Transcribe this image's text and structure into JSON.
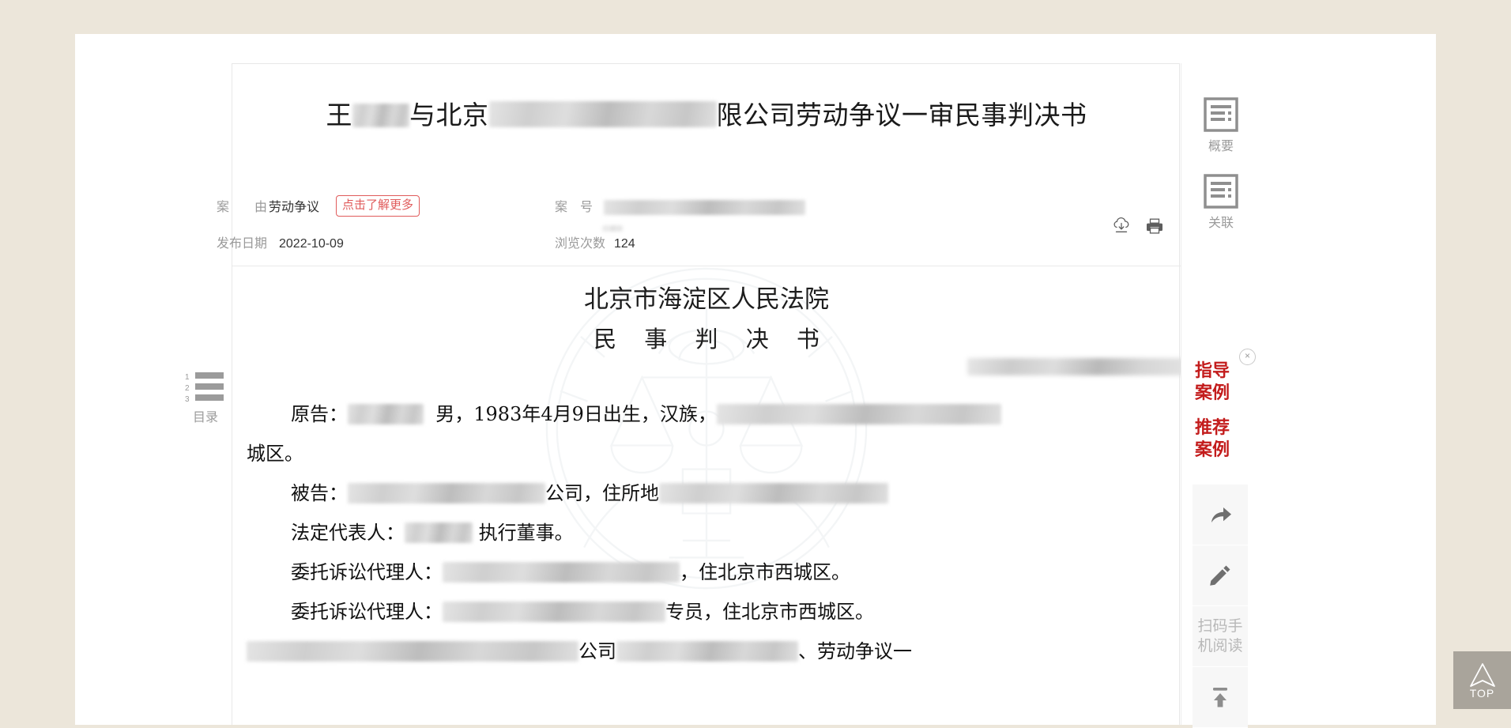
{
  "document": {
    "title_prefix": "王",
    "title_mid": "与北京",
    "title_suffix": "限公司劳动争议一审民事判决书",
    "court_name": "北京市海淀区人民法院",
    "doc_type": "民 事 判 决 书"
  },
  "meta": {
    "case_cause_label": "案　　由",
    "case_cause_value": "劳动争议",
    "more_badge": "点击了解更多",
    "case_number_label": "案　号",
    "publish_date_label": "发布日期",
    "publish_date_value": "2022-10-09",
    "views_label": "浏览次数",
    "views_value": "124",
    "download_icon": "cloud-download-icon",
    "print_icon": "printer-icon"
  },
  "body": {
    "plaintiff_label": "原告：",
    "plaintiff_line_tail": "男，1983年4月9日出生，汉族，",
    "plaintiff_line2": "城区。",
    "defendant_label": "被告：",
    "defendant_tail": "公司，住所地",
    "legal_rep_label": "法定代表人：",
    "legal_rep_tail": "执行董事。",
    "agent1_label": "委托诉讼代理人：",
    "agent1_tail": "，住北京市西城区。",
    "agent2_label": "委托诉讼代理人：",
    "agent2_tail": "专员，住北京市西城区。",
    "last_line_tail": "、劳动争议一",
    "last_line_company": "公司"
  },
  "left_widget": {
    "toc_label": "目录",
    "toc_icon": "numbered-list-icon"
  },
  "right_rail": {
    "items": [
      {
        "label": "概要",
        "icon": "summary-doc-icon"
      },
      {
        "label": "关联",
        "icon": "related-doc-icon"
      }
    ]
  },
  "promo": {
    "items": [
      "指导案例",
      "推荐案例"
    ],
    "close_label": "×",
    "close_icon": "close-icon",
    "color": "#c31c1c"
  },
  "tools": [
    {
      "name": "share",
      "icon": "share-arrow-icon",
      "label": ""
    },
    {
      "name": "edit",
      "icon": "pencil-icon",
      "label": ""
    },
    {
      "name": "qr-read",
      "icon": "",
      "label": "扫码手机阅读"
    },
    {
      "name": "scroll-top",
      "icon": "upload-top-icon",
      "label": ""
    }
  ],
  "top_button": {
    "label": "TOP",
    "icon": "navigation-arrow-icon",
    "background": "#a9a49b"
  },
  "colors": {
    "page_background": "#ece6da",
    "card_background": "#ffffff",
    "muted_text": "#9b9b9b",
    "accent_red": "#c31c1c",
    "badge_red": "#e05b5b"
  }
}
